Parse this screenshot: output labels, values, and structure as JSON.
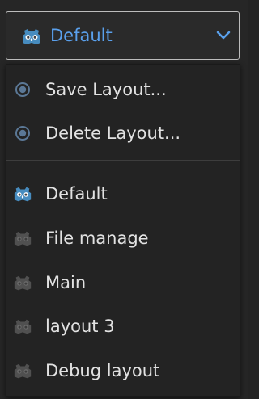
{
  "layout_selector": {
    "selected": "Default",
    "icon": "godot-logo-icon",
    "dropdown_icon": "chevron-down-icon",
    "accent_color": "#5aa0ec"
  },
  "menu": {
    "actions": [
      {
        "label": "Save Layout...",
        "icon": "radio-dot-icon"
      },
      {
        "label": "Delete Layout...",
        "icon": "radio-dot-icon"
      }
    ],
    "layouts": [
      {
        "label": "Default",
        "icon": "godot-logo-icon",
        "active": true
      },
      {
        "label": "File manage",
        "icon": "godot-logo-icon",
        "active": false
      },
      {
        "label": "Main",
        "icon": "godot-logo-icon",
        "active": false
      },
      {
        "label": "layout 3",
        "icon": "godot-logo-icon",
        "active": false
      },
      {
        "label": "Debug layout",
        "icon": "godot-logo-icon",
        "active": false
      }
    ]
  }
}
